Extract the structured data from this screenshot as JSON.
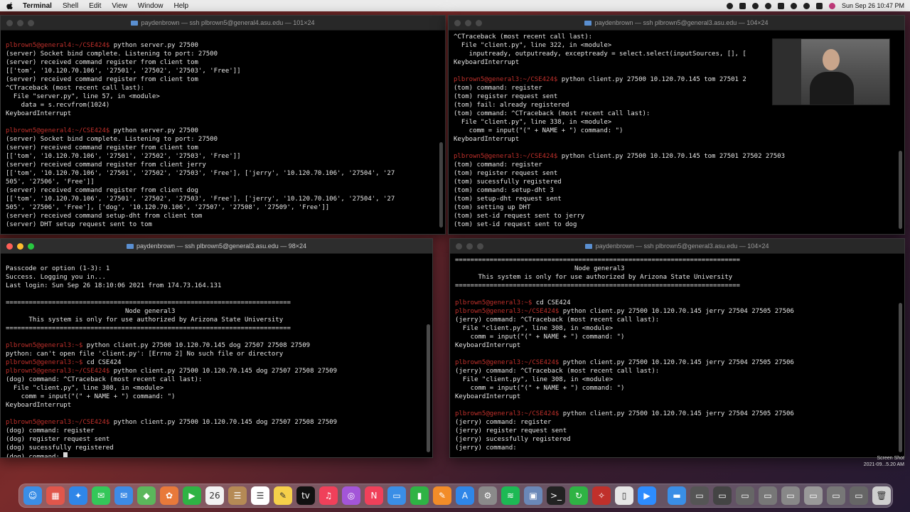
{
  "menubar": {
    "app_name": "Terminal",
    "items": [
      "Shell",
      "Edit",
      "View",
      "Window",
      "Help"
    ],
    "clock": "Sun Sep 26  10:47 PM"
  },
  "windows": {
    "top_left": {
      "title": "paydenbrown — ssh plbrown5@general4.asu.edu — 101×24",
      "lines": [
        {
          "p": "",
          "t": ""
        },
        {
          "p": "plbrown5@general4:~/CSE424$",
          "t": " python server.py 27500"
        },
        {
          "p": "",
          "t": "(server) Socket bind complete. Listening to port: 27500"
        },
        {
          "p": "",
          "t": "(server) received command register from client tom"
        },
        {
          "p": "",
          "t": "[['tom', '10.120.70.106', '27501', '27502', '27503', 'Free']]"
        },
        {
          "p": "",
          "t": "(server) received command register from client tom"
        },
        {
          "p": "",
          "t": "^CTraceback (most recent call last):"
        },
        {
          "p": "",
          "t": "  File \"server.py\", line 57, in <module>"
        },
        {
          "p": "",
          "t": "    data = s.recvfrom(1024)"
        },
        {
          "p": "",
          "t": "KeyboardInterrupt"
        },
        {
          "p": "",
          "t": ""
        },
        {
          "p": "plbrown5@general4:~/CSE424$",
          "t": " python server.py 27500"
        },
        {
          "p": "",
          "t": "(server) Socket bind complete. Listening to port: 27500"
        },
        {
          "p": "",
          "t": "(server) received command register from client tom"
        },
        {
          "p": "",
          "t": "[['tom', '10.120.70.106', '27501', '27502', '27503', 'Free']]"
        },
        {
          "p": "",
          "t": "(server) received command register from client jerry"
        },
        {
          "p": "",
          "t": "[['tom', '10.120.70.106', '27501', '27502', '27503', 'Free'], ['jerry', '10.120.70.106', '27504', '27"
        },
        {
          "p": "",
          "t": "505', '27506', 'Free']]"
        },
        {
          "p": "",
          "t": "(server) received command register from client dog"
        },
        {
          "p": "",
          "t": "[['tom', '10.120.70.106', '27501', '27502', '27503', 'Free'], ['jerry', '10.120.70.106', '27504', '27"
        },
        {
          "p": "",
          "t": "505', '27506', 'Free'], ['dog', '10.120.70.106', '27507', '27508', '27509', 'Free']]"
        },
        {
          "p": "",
          "t": "(server) received command setup-dht from client tom"
        },
        {
          "p": "",
          "t": "(server) DHT setup request sent to tom"
        },
        {
          "p": "",
          "t": ""
        }
      ]
    },
    "top_right": {
      "title": "paydenbrown — ssh plbrown5@general3.asu.edu — 104×24",
      "lines": [
        {
          "p": "",
          "t": "^CTraceback (most recent call last):"
        },
        {
          "p": "",
          "t": "  File \"client.py\", line 322, in <module>"
        },
        {
          "p": "",
          "t": "    inputready, outputready, exceptready = select.select(inputSources, [], ["
        },
        {
          "p": "",
          "t": "KeyboardInterrupt"
        },
        {
          "p": "",
          "t": ""
        },
        {
          "p": "plbrown5@general3:~/CSE424$",
          "t": " python client.py 27500 10.120.70.145 tom 27501 2"
        },
        {
          "p": "",
          "t": "(tom) command: register"
        },
        {
          "p": "",
          "t": "(tom) register request sent"
        },
        {
          "p": "",
          "t": "(tom) fail: already registered"
        },
        {
          "p": "",
          "t": "(tom) command: ^CTraceback (most recent call last):"
        },
        {
          "p": "",
          "t": "  File \"client.py\", line 338, in <module>"
        },
        {
          "p": "",
          "t": "    comm = input(\"(\" + NAME + \") command: \")"
        },
        {
          "p": "",
          "t": "KeyboardInterrupt"
        },
        {
          "p": "",
          "t": ""
        },
        {
          "p": "plbrown5@general3:~/CSE424$",
          "t": " python client.py 27500 10.120.70.145 tom 27501 27502 27503"
        },
        {
          "p": "",
          "t": "(tom) command: register"
        },
        {
          "p": "",
          "t": "(tom) register request sent"
        },
        {
          "p": "",
          "t": "(tom) sucessfully registered"
        },
        {
          "p": "",
          "t": "(tom) command: setup-dht 3"
        },
        {
          "p": "",
          "t": "(tom) setup-dht request sent"
        },
        {
          "p": "",
          "t": "(tom) setting up DHT"
        },
        {
          "p": "",
          "t": "(tom) set-id request sent to jerry"
        },
        {
          "p": "",
          "t": "(tom) set-id request sent to dog"
        },
        {
          "p": "",
          "t": ""
        }
      ]
    },
    "bottom_left": {
      "title": "paydenbrown — ssh plbrown5@general3.asu.edu — 98×24",
      "lines": [
        {
          "p": "",
          "t": ""
        },
        {
          "p": "",
          "t": "Passcode or option (1-3): 1"
        },
        {
          "p": "",
          "t": "Success. Logging you in..."
        },
        {
          "p": "",
          "t": "Last login: Sun Sep 26 18:10:06 2021 from 174.73.164.131"
        },
        {
          "p": "",
          "t": ""
        },
        {
          "p": "",
          "t": "=========================================================================="
        },
        {
          "p": "",
          "t": "                               Node general3"
        },
        {
          "p": "",
          "t": "      This system is only for use authorized by Arizona State University"
        },
        {
          "p": "",
          "t": "=========================================================================="
        },
        {
          "p": "",
          "t": ""
        },
        {
          "p": "plbrown5@general3:~$",
          "t": " python client.py 27500 10.120.70.145 dog 27507 27508 27509"
        },
        {
          "p": "",
          "t": "python: can't open file 'client.py': [Errno 2] No such file or directory"
        },
        {
          "p": "plbrown5@general3:~$",
          "t": " cd CSE424"
        },
        {
          "p": "plbrown5@general3:~/CSE424$",
          "t": " python client.py 27500 10.120.70.145 dog 27507 27508 27509"
        },
        {
          "p": "",
          "t": "(dog) command: ^CTraceback (most recent call last):"
        },
        {
          "p": "",
          "t": "  File \"client.py\", line 308, in <module>"
        },
        {
          "p": "",
          "t": "    comm = input(\"(\" + NAME + \") command: \")"
        },
        {
          "p": "",
          "t": "KeyboardInterrupt"
        },
        {
          "p": "",
          "t": ""
        },
        {
          "p": "plbrown5@general3:~/CSE424$",
          "t": " python client.py 27500 10.120.70.145 dog 27507 27508 27509"
        },
        {
          "p": "",
          "t": "(dog) command: register"
        },
        {
          "p": "",
          "t": "(dog) register request sent"
        },
        {
          "p": "",
          "t": "(dog) sucessfully registered"
        },
        {
          "p": "",
          "t": "(dog) command: ",
          "cursor": true
        }
      ]
    },
    "bottom_right": {
      "title": "paydenbrown — ssh plbrown5@general3.asu.edu — 104×24",
      "lines": [
        {
          "p": "",
          "t": "=========================================================================="
        },
        {
          "p": "",
          "t": "                               Node general3"
        },
        {
          "p": "",
          "t": "      This system is only for use authorized by Arizona State University"
        },
        {
          "p": "",
          "t": "=========================================================================="
        },
        {
          "p": "",
          "t": ""
        },
        {
          "p": "plbrown5@general3:~$",
          "t": " cd CSE424"
        },
        {
          "p": "plbrown5@general3:~/CSE424$",
          "t": " python client.py 27500 10.120.70.145 jerry 27504 27505 27506"
        },
        {
          "p": "",
          "t": "(jerry) command: ^CTraceback (most recent call last):"
        },
        {
          "p": "",
          "t": "  File \"client.py\", line 308, in <module>"
        },
        {
          "p": "",
          "t": "    comm = input(\"(\" + NAME + \") command: \")"
        },
        {
          "p": "",
          "t": "KeyboardInterrupt"
        },
        {
          "p": "",
          "t": ""
        },
        {
          "p": "plbrown5@general3:~/CSE424$",
          "t": " python client.py 27500 10.120.70.145 jerry 27504 27505 27506"
        },
        {
          "p": "",
          "t": "(jerry) command: ^CTraceback (most recent call last):"
        },
        {
          "p": "",
          "t": "  File \"client.py\", line 308, in <module>"
        },
        {
          "p": "",
          "t": "    comm = input(\"(\" + NAME + \") command: \")"
        },
        {
          "p": "",
          "t": "KeyboardInterrupt"
        },
        {
          "p": "",
          "t": ""
        },
        {
          "p": "plbrown5@general3:~/CSE424$",
          "t": " python client.py 27500 10.120.70.145 jerry 27504 27505 27506"
        },
        {
          "p": "",
          "t": "(jerry) command: register"
        },
        {
          "p": "",
          "t": "(jerry) register request sent"
        },
        {
          "p": "",
          "t": "(jerry) sucessfully registered"
        },
        {
          "p": "",
          "t": "(jerry) command:"
        },
        {
          "p": "",
          "t": ""
        }
      ]
    }
  },
  "screenshot_thumb": {
    "label": "Screen Shot",
    "date": "2021-09...5.20 AM"
  },
  "dock": {
    "apps": [
      {
        "name": "finder-icon",
        "glyph": "☺",
        "color": "#3a8ee6"
      },
      {
        "name": "launchpad-icon",
        "glyph": "▦",
        "color": "#e0564b"
      },
      {
        "name": "safari-icon",
        "glyph": "✦",
        "color": "#2f86e8"
      },
      {
        "name": "messages-icon",
        "glyph": "✉",
        "color": "#34c759"
      },
      {
        "name": "mail-icon",
        "glyph": "✉",
        "color": "#3d8be6"
      },
      {
        "name": "maps-icon",
        "glyph": "◆",
        "color": "#5bb75b"
      },
      {
        "name": "photos-icon",
        "glyph": "✿",
        "color": "#e8793a"
      },
      {
        "name": "facetime-icon",
        "glyph": "▶",
        "color": "#2fb344"
      },
      {
        "name": "calendar-icon",
        "glyph": "26",
        "color": "#f2f2f2"
      },
      {
        "name": "contacts-icon",
        "glyph": "☰",
        "color": "#b58a55"
      },
      {
        "name": "reminders-icon",
        "glyph": "☰",
        "color": "#ffffff"
      },
      {
        "name": "notes-icon",
        "glyph": "✎",
        "color": "#f5d04a"
      },
      {
        "name": "tv-icon",
        "glyph": "tv",
        "color": "#111111"
      },
      {
        "name": "music-icon",
        "glyph": "♫",
        "color": "#f0405a"
      },
      {
        "name": "podcasts-icon",
        "glyph": "◎",
        "color": "#a355d8"
      },
      {
        "name": "news-icon",
        "glyph": "N",
        "color": "#f0405a"
      },
      {
        "name": "keynote-icon",
        "glyph": "▭",
        "color": "#3a8ee6"
      },
      {
        "name": "numbers-icon",
        "glyph": "▮",
        "color": "#2fb344"
      },
      {
        "name": "pages-icon",
        "glyph": "✎",
        "color": "#f28c28"
      },
      {
        "name": "app-store-icon",
        "glyph": "A",
        "color": "#2f86e8"
      },
      {
        "name": "system-preferences-icon",
        "glyph": "⚙",
        "color": "#8a8a8a"
      },
      {
        "name": "spotify-icon",
        "glyph": "≋",
        "color": "#1db954"
      },
      {
        "name": "preview-icon",
        "glyph": "▣",
        "color": "#6a88b8"
      },
      {
        "name": "terminal-icon",
        "glyph": ">_",
        "color": "#222222"
      },
      {
        "name": "refresh-app-icon",
        "glyph": "↻",
        "color": "#2fb344"
      },
      {
        "name": "compass-app-icon",
        "glyph": "✧",
        "color": "#c0302b"
      },
      {
        "name": "document-icon",
        "glyph": "▯",
        "color": "#e6e6e6"
      },
      {
        "name": "zoom-icon",
        "glyph": "▶",
        "color": "#2d8cff"
      }
    ],
    "recents": [
      {
        "name": "folder-icon",
        "glyph": "▬",
        "color": "#3a8ee6"
      },
      {
        "name": "window-thumb-icon",
        "glyph": "▭",
        "color": "#555555"
      },
      {
        "name": "window-thumb-icon",
        "glyph": "▭",
        "color": "#444444"
      },
      {
        "name": "window-thumb-icon",
        "glyph": "▭",
        "color": "#666666"
      },
      {
        "name": "window-thumb-icon",
        "glyph": "▭",
        "color": "#777777"
      },
      {
        "name": "window-thumb-icon",
        "glyph": "▭",
        "color": "#888888"
      },
      {
        "name": "window-thumb-icon",
        "glyph": "▭",
        "color": "#999999"
      },
      {
        "name": "window-thumb-icon",
        "glyph": "▭",
        "color": "#777777"
      },
      {
        "name": "window-thumb-icon",
        "glyph": "▭",
        "color": "#666666"
      },
      {
        "name": "trash-icon",
        "glyph": "🗑",
        "color": "#cfcfcf"
      }
    ]
  }
}
